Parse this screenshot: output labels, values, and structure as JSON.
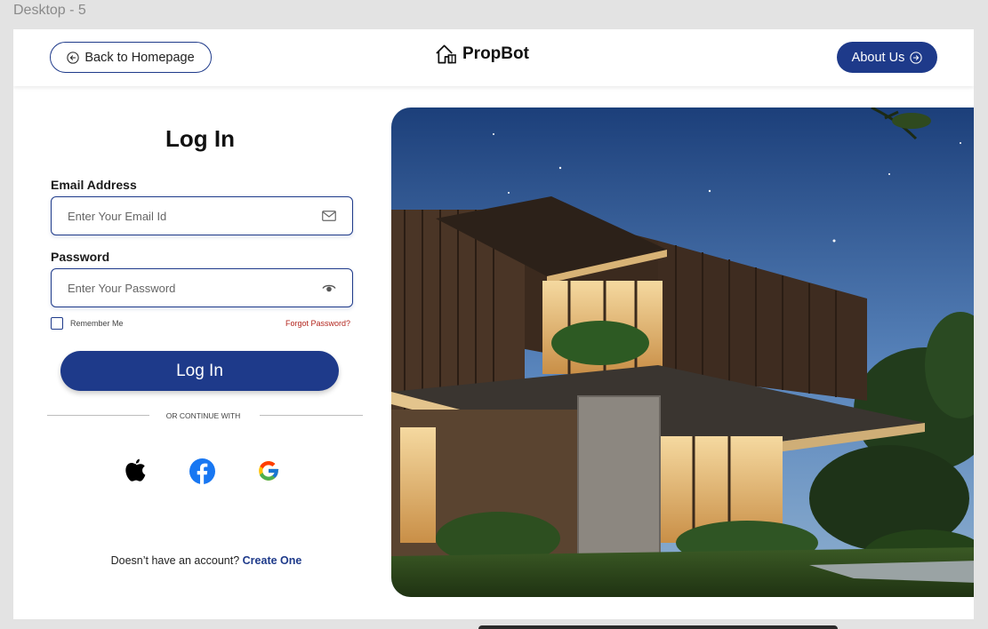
{
  "frame": {
    "label": "Desktop - 5"
  },
  "header": {
    "back_label": "Back to Homepage",
    "logo_text": "PropBot",
    "about_label": "About Us"
  },
  "login": {
    "title": "Log In",
    "email_label": "Email Address",
    "email_placeholder": "Enter Your Email Id",
    "password_label": "Password",
    "password_placeholder": "Enter Your Password",
    "remember_label": "Remember Me",
    "forgot_label": "Forgot Password?",
    "submit_label": "Log In",
    "divider_text": "OR CONTINUE WITH",
    "social": [
      "apple-icon",
      "facebook-icon",
      "google-icon"
    ],
    "signup_prompt": "Doesn’t have an account?",
    "signup_link": "Create One"
  },
  "colors": {
    "primary": "#1e3a8a",
    "forgot": "#b3261e",
    "facebook": "#1877f2"
  }
}
